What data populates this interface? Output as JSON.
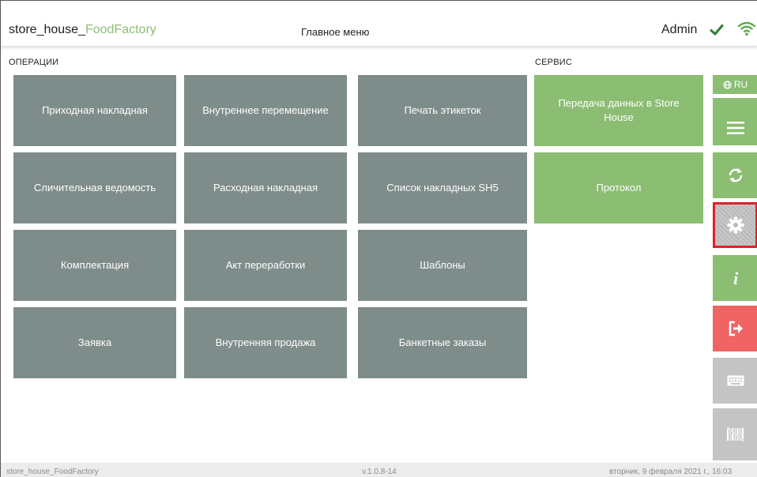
{
  "header": {
    "app_title_prefix": "store_house_",
    "app_title_accent": "FoodFactory",
    "center_title": "Главное меню",
    "user": "Admin"
  },
  "sections": {
    "operations": "ОПЕРАЦИИ",
    "service": "СЕРВИС"
  },
  "operations": [
    "Приходная накладная",
    "Внутреннее перемещение",
    "Печать этикеток",
    "Сличительная ведомость",
    "Расходная накладная",
    "Список накладных SH5",
    "Комплектация",
    "Акт переработки",
    "Шаблоны",
    "Заявка",
    "Внутренняя продажа",
    "Банкетные заказы"
  ],
  "service": [
    "Передача данных в Store House",
    "Протокол"
  ],
  "rail": {
    "lang_label": "RU",
    "buttons": [
      {
        "name": "menu-icon",
        "color": "#8bbd72"
      },
      {
        "name": "sync-icon",
        "color": "#8bbd72"
      },
      {
        "name": "gear-icon",
        "color": "#c4c4c4"
      },
      {
        "name": "info-icon",
        "color": "#8bbd72"
      },
      {
        "name": "logout-icon",
        "color": "#f06464"
      },
      {
        "name": "keyboard-icon",
        "color": "#c4c4c4"
      },
      {
        "name": "barcode-off-icon",
        "color": "#c4c4c4"
      }
    ]
  },
  "footer": {
    "left": "store_house_FoodFactory",
    "version": "v.1.0.8-14",
    "datetime": "вторник, 9 февраля 2021 г., 16:03"
  },
  "colors": {
    "accent_green": "#8bbd72",
    "tile_gray": "#7e8c8a",
    "danger_red": "#f06464"
  }
}
